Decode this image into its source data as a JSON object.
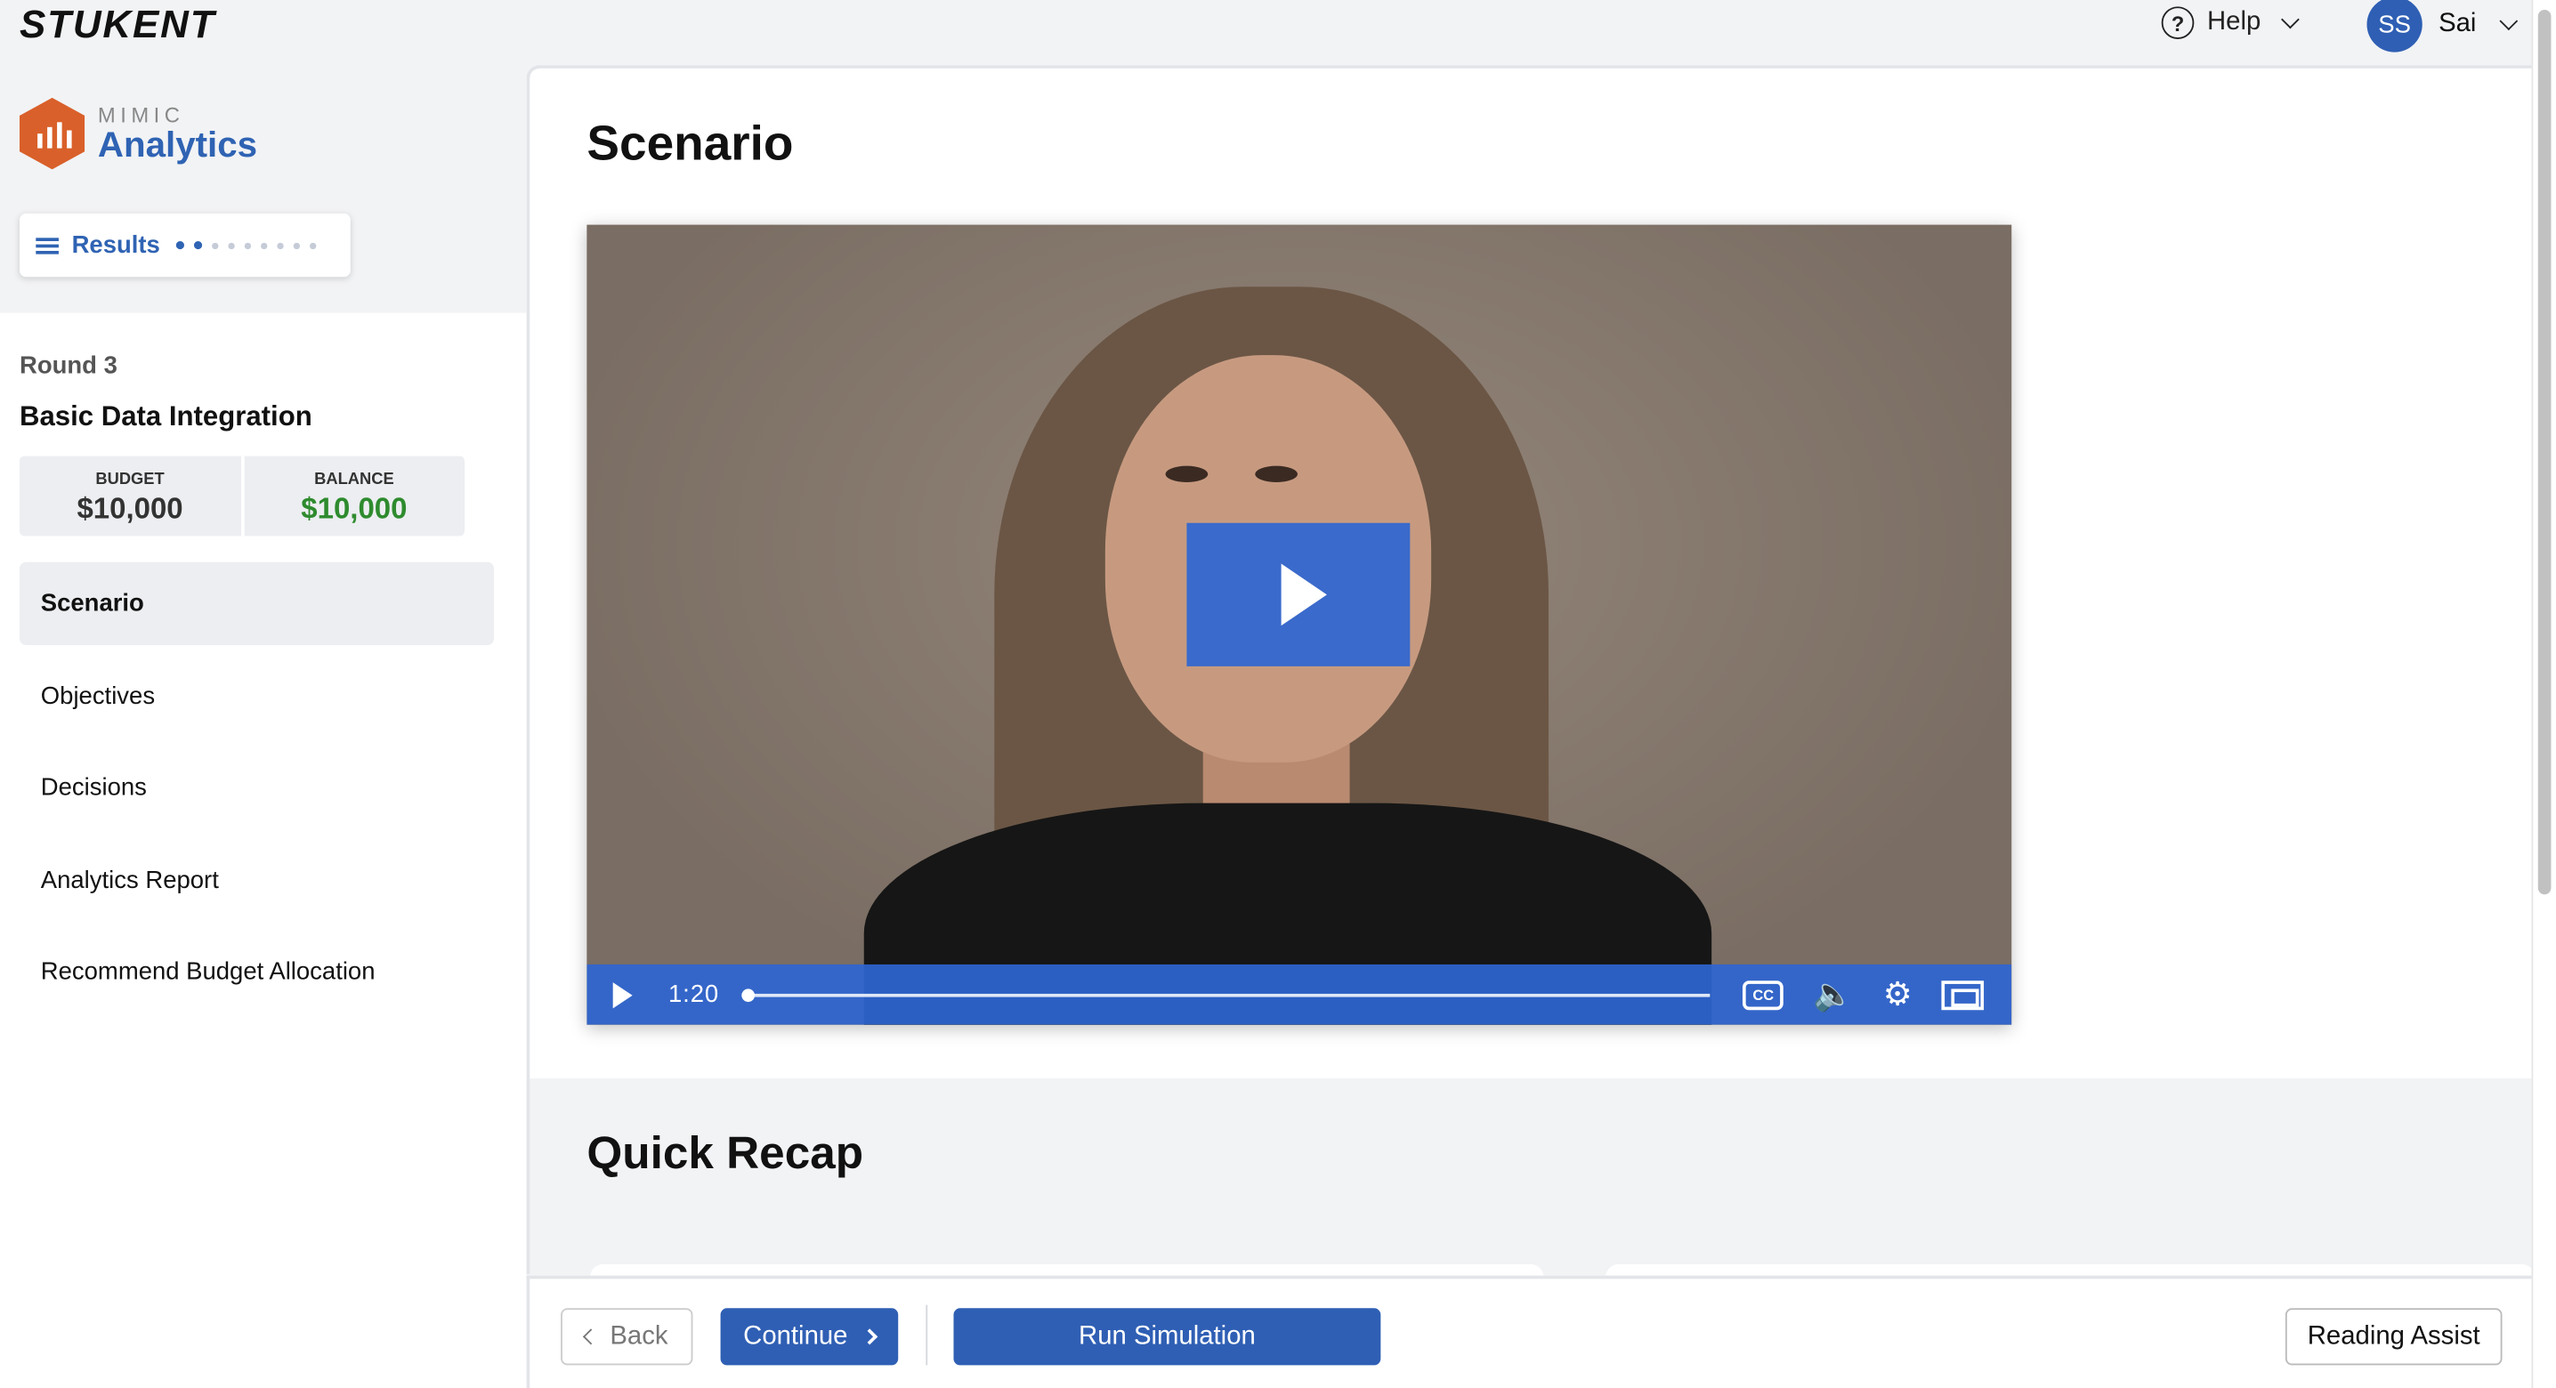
{
  "topbar": {
    "brand": "STUKENT",
    "help_label": "Help",
    "user_initials": "SS",
    "user_name": "Sai"
  },
  "sidebar": {
    "product_small": "MIMIC",
    "product_big": "Analytics",
    "results_label": "Results",
    "progress_dots_total": 9,
    "progress_dots_active": 2,
    "round_label": "Round 3",
    "module_title": "Basic Data Integration",
    "budget_label": "BUDGET",
    "budget_value": "$10,000",
    "balance_label": "BALANCE",
    "balance_value": "$10,000",
    "nav": [
      {
        "label": "Scenario",
        "active": true
      },
      {
        "label": "Objectives"
      },
      {
        "label": "Decisions"
      },
      {
        "label": "Analytics Report"
      },
      {
        "label": "Recommend Budget Allocation"
      }
    ]
  },
  "main": {
    "title": "Scenario",
    "video": {
      "time": "1:20",
      "cc_label": "CC",
      "progress": 0
    },
    "recap_title": "Quick Recap"
  },
  "footer": {
    "back_label": "Back",
    "continue_label": "Continue",
    "run_label": "Run Simulation",
    "reading_label": "Reading Assist"
  },
  "colors": {
    "accent": "#2f5fb4",
    "brand_orange": "#d9602a",
    "balance_green": "#2e8b2e"
  }
}
